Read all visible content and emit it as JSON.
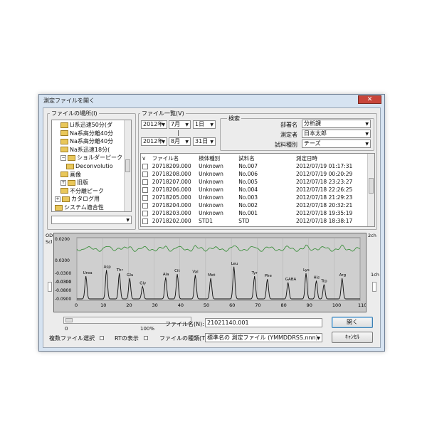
{
  "window": {
    "title": "測定ファイルを開く",
    "close_glyph": "✕"
  },
  "location": {
    "label": "ファイルの場所(I)",
    "tree": [
      {
        "label": "Li系迅速50分(ダ",
        "indent": 1,
        "expander": ""
      },
      {
        "label": "Na系高分離40分",
        "indent": 1,
        "expander": ""
      },
      {
        "label": "Na系高分離40分",
        "indent": 1,
        "expander": ""
      },
      {
        "label": "Na系迅速18分(",
        "indent": 1,
        "expander": ""
      },
      {
        "label": "ショルダーピーク",
        "indent": 1,
        "expander": "−"
      },
      {
        "label": "Deconvolutio",
        "indent": 2,
        "expander": ""
      },
      {
        "label": "画像",
        "indent": 1,
        "expander": ""
      },
      {
        "label": "旧版",
        "indent": 1,
        "expander": "+"
      },
      {
        "label": "不分離ピーク",
        "indent": 1,
        "expander": ""
      },
      {
        "label": "カタログ用",
        "indent": 0,
        "expander": "+"
      },
      {
        "label": "システム適合性",
        "indent": 0,
        "expander": ""
      }
    ],
    "drive_value": ""
  },
  "filelist": {
    "label": "ファイル一覧(V)",
    "date_from": {
      "year": "2012年",
      "month": "7月",
      "day": "1日"
    },
    "range_sep": "|",
    "date_to": {
      "year": "2012年",
      "month": "8月",
      "day": "31日"
    },
    "search": {
      "label": "検索",
      "dept_label": "部署名",
      "dept_value": "分析課",
      "person_label": "測定者",
      "person_value": "日本太郎",
      "sample_label": "試料種別",
      "sample_value": "チーズ"
    },
    "columns": [
      "v",
      "ファイル名",
      "検体種別",
      "試料名",
      "測定日時"
    ],
    "rows": [
      [
        "",
        "20718209.000",
        "Unknown",
        "No.007",
        "2012/07/19 01:17:31"
      ],
      [
        "",
        "20718208.000",
        "Unknown",
        "No.006",
        "2012/07/19 00:20:29"
      ],
      [
        "",
        "20718207.000",
        "Unknown",
        "No.005",
        "2012/07/18 23:23:27"
      ],
      [
        "",
        "20718206.000",
        "Unknown",
        "No.004",
        "2012/07/18 22:26:25"
      ],
      [
        "",
        "20718205.000",
        "Unknown",
        "No.003",
        "2012/07/18 21:29:23"
      ],
      [
        "",
        "20718204.000",
        "Unknown",
        "No.002",
        "2012/07/18 20:32:21"
      ],
      [
        "",
        "20718203.000",
        "Unknown",
        "No.001",
        "2012/07/18 19:35:19"
      ],
      [
        "",
        "20718202.000",
        "STD1",
        "STD",
        "2012/07/18 18:38:17"
      ]
    ]
  },
  "preview": {
    "od_label": "OD",
    "scl_label": "Scl",
    "ch2_label": "2ch",
    "ch1_label": "1ch",
    "yticks_top": [
      "0.0200",
      "0.0300",
      "-0.0300"
    ],
    "yticks_bottom": [
      "-0.0300",
      "-0.0300",
      "-0.0800",
      "-0.0900"
    ],
    "xticks": [
      "0",
      "10",
      "20",
      "30",
      "40",
      "50",
      "60",
      "70",
      "80",
      "90",
      "100",
      "110"
    ],
    "slider_min": "0",
    "slider_max": "100%",
    "peaks": [
      {
        "label": "Urea",
        "x": 3.5,
        "h": 0.55
      },
      {
        "label": "Asp",
        "x": 11.5,
        "h": 0.7
      },
      {
        "label": "Thr",
        "x": 16.5,
        "h": 0.62
      },
      {
        "label": "Glu",
        "x": 20.5,
        "h": 0.5
      },
      {
        "label": "Gly",
        "x": 25.5,
        "h": 0.3
      },
      {
        "label": "Ala",
        "x": 34.5,
        "h": 0.52
      },
      {
        "label": "Cit",
        "x": 39,
        "h": 0.6
      },
      {
        "label": "Val",
        "x": 46,
        "h": 0.58
      },
      {
        "label": "Met",
        "x": 52,
        "h": 0.5
      },
      {
        "label": "Leu",
        "x": 61,
        "h": 0.78
      },
      {
        "label": "Tyr",
        "x": 69,
        "h": 0.55
      },
      {
        "label": "Phe",
        "x": 74,
        "h": 0.48
      },
      {
        "label": "GABA",
        "x": 82,
        "h": 0.4
      },
      {
        "label": "Lys",
        "x": 89,
        "h": 0.62
      },
      {
        "label": "His",
        "x": 93,
        "h": 0.44
      },
      {
        "label": "Trp",
        "x": 96,
        "h": 0.35
      },
      {
        "label": "Arg",
        "x": 103,
        "h": 0.5
      }
    ]
  },
  "bottom": {
    "filename_label": "ファイル名(N):",
    "filename_value": "21021140.001",
    "filetype_label": "ファイルの種類(T):",
    "filetype_value": "標準名の 測定ファイル (YMMDDRSS.nnn)",
    "multi_select_label": "複数ファイル選択",
    "rt_label": "RTの表示",
    "open_label": "開く",
    "cancel_label": "ｷｬﾝｾﾙ"
  },
  "colors": {
    "accent": "#3c7fb1",
    "chrom_black": "#111111",
    "chrom_green": "#2f8a2f"
  }
}
